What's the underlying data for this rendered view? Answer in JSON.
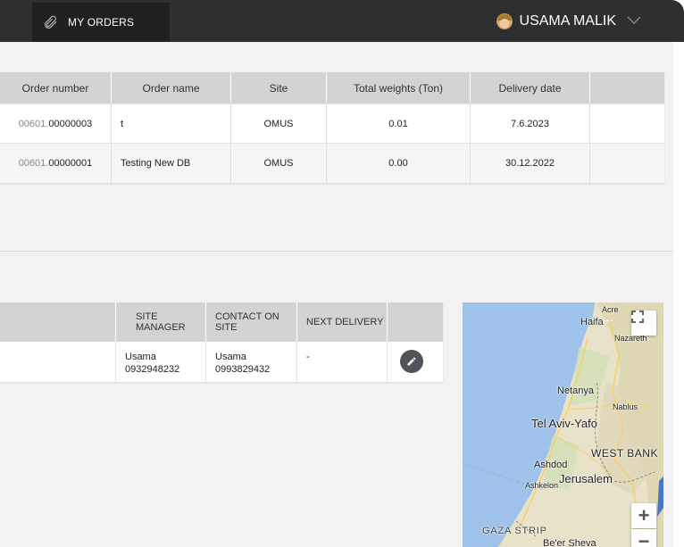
{
  "topbar": {
    "tab_label": "MY ORDERS",
    "user_name": "USAMA MALIK"
  },
  "orders": {
    "headers": [
      "Order number",
      "Order name",
      "Site",
      "Total weights (Ton)",
      "Delivery date",
      ""
    ],
    "rows": [
      {
        "prefix": "00601.",
        "number": "00000003",
        "name": "t",
        "site": "OMUS",
        "weight": "0.01",
        "date": "7.6.2023"
      },
      {
        "prefix": "00601.",
        "number": "00000001",
        "name": "Testing New DB",
        "site": "OMUS",
        "weight": "0.00",
        "date": "30.12.2022"
      }
    ]
  },
  "sites": {
    "headers": [
      "",
      "SITE MANAGER",
      "CONTACT ON SITE",
      "NEXT DELIVERY",
      ""
    ],
    "rows": [
      {
        "manager_name": "Usama",
        "manager_phone": "0932948232",
        "contact_name": "Usama",
        "contact_phone": "0993829432",
        "next_delivery": "-"
      }
    ]
  },
  "map": {
    "labels": {
      "haifa": "Haifa",
      "acre": "Acre",
      "nazareth": "Nazareth",
      "netanya": "Netanya",
      "nablus": "Nablus",
      "telaviv": "Tel Aviv-Yafo",
      "westbank": "WEST BANK",
      "ashdod": "Ashdod",
      "ashkelon": "Ashkelon",
      "jerusalem": "Jerusalem",
      "gaza": "GAZA STRIP",
      "beersheva": "Be'er Sheva"
    },
    "zoom_in": "+",
    "zoom_out": "−"
  }
}
